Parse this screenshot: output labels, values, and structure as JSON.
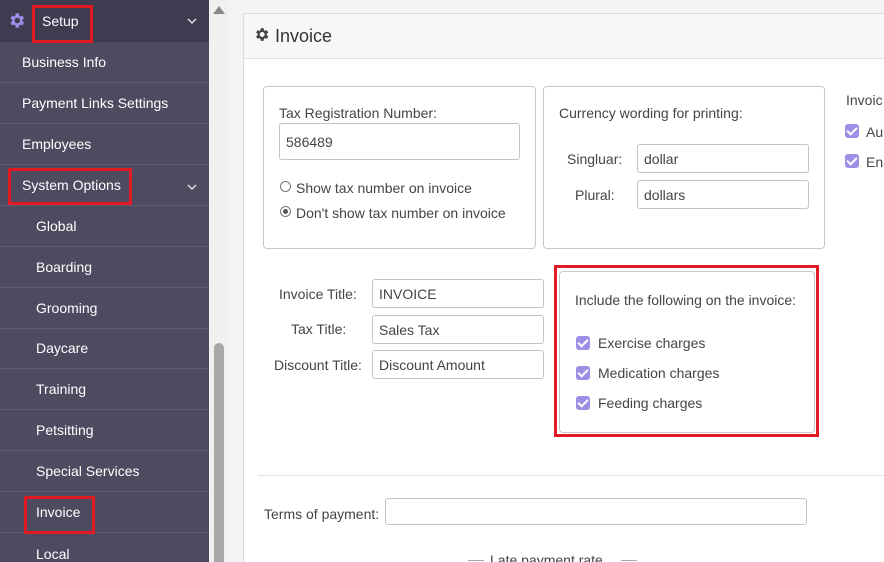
{
  "sidebar": {
    "setup_label": "Setup",
    "items": [
      {
        "label": "Business Info"
      },
      {
        "label": "Payment Links Settings"
      },
      {
        "label": "Employees"
      },
      {
        "label": "System Options"
      },
      {
        "label": "Global"
      },
      {
        "label": "Boarding"
      },
      {
        "label": "Grooming"
      },
      {
        "label": "Daycare"
      },
      {
        "label": "Training"
      },
      {
        "label": "Petsitting"
      },
      {
        "label": "Special Services"
      },
      {
        "label": "Invoice"
      },
      {
        "label": "Local"
      }
    ]
  },
  "panel": {
    "title": "Invoice",
    "tax": {
      "label": "Tax Registration Number:",
      "value": "586489",
      "options": [
        "Show tax number on invoice",
        "Don't show tax number on invoice"
      ],
      "selected_index": 1
    },
    "currency": {
      "label": "Currency wording for printing:",
      "singular_label": "Singluar:",
      "singular_value": "dollar",
      "plural_label": "Plural:",
      "plural_value": "dollars"
    },
    "right_partial": {
      "header": "Invoic",
      "opt1": "Au",
      "opt2": "Ena"
    },
    "titles": {
      "invoice_label": "Invoice Title:",
      "invoice_value": "INVOICE",
      "tax_label": "Tax Title:",
      "tax_value": "Sales Tax",
      "discount_label": "Discount Title:",
      "discount_value": "Discount Amount"
    },
    "include": {
      "label": "Include the following on the invoice:",
      "items": [
        "Exercise charges",
        "Medication charges",
        "Feeding charges"
      ]
    },
    "terms_label": "Terms of payment:",
    "terms_value": "",
    "late_rate_label": "Late payment rate"
  },
  "colors": {
    "sidebar_bg": "#4e4a5f",
    "sidebar_header_bg": "#3f3b50",
    "highlight": "#e01b24",
    "checkbox": "#9c8fe6"
  }
}
